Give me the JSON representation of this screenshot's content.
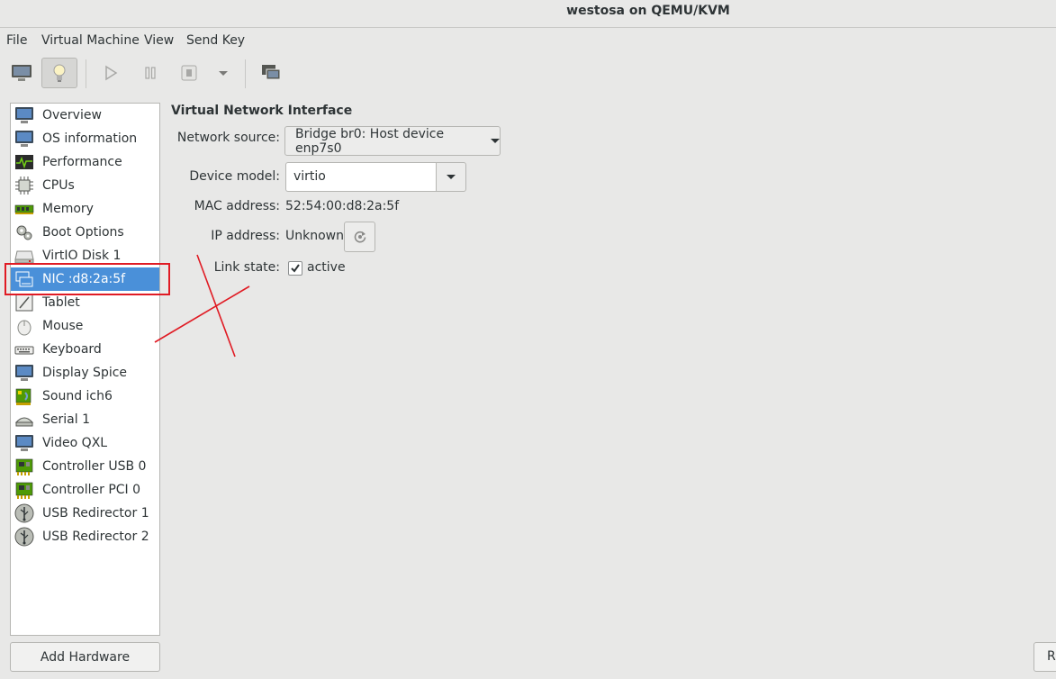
{
  "window": {
    "title": "westosa on QEMU/KVM"
  },
  "menubar": {
    "items": [
      "File",
      "Virtual Machine",
      "View",
      "Send Key"
    ]
  },
  "toolbar": {
    "buttons": [
      "monitor-icon",
      "lightbulb-icon",
      "play-icon",
      "pause-icon",
      "stop-icon",
      "dropdown-arrow-icon",
      "screens-icon"
    ],
    "active": "lightbulb-icon"
  },
  "sidebar": {
    "items": [
      {
        "label": "Overview",
        "icon": "monitor-icon"
      },
      {
        "label": "OS information",
        "icon": "monitor-icon"
      },
      {
        "label": "Performance",
        "icon": "performance-graph-icon"
      },
      {
        "label": "CPUs",
        "icon": "cpu-chip-icon"
      },
      {
        "label": "Memory",
        "icon": "memory-module-icon"
      },
      {
        "label": "Boot Options",
        "icon": "gears-icon"
      },
      {
        "label": "VirtIO Disk 1",
        "icon": "disk-drive-icon"
      },
      {
        "label": "NIC :d8:2a:5f",
        "icon": "network-card-icon",
        "selected": true
      },
      {
        "label": "Tablet",
        "icon": "tablet-icon"
      },
      {
        "label": "Mouse",
        "icon": "mouse-icon"
      },
      {
        "label": "Keyboard",
        "icon": "keyboard-icon"
      },
      {
        "label": "Display Spice",
        "icon": "monitor-icon"
      },
      {
        "label": "Sound ich6",
        "icon": "sound-card-icon"
      },
      {
        "label": "Serial 1",
        "icon": "serial-port-icon"
      },
      {
        "label": "Video QXL",
        "icon": "monitor-icon"
      },
      {
        "label": "Controller USB 0",
        "icon": "controller-card-icon"
      },
      {
        "label": "Controller PCI 0",
        "icon": "controller-card-icon"
      },
      {
        "label": "USB Redirector 1",
        "icon": "usb-icon"
      },
      {
        "label": "USB Redirector 2",
        "icon": "usb-icon"
      }
    ]
  },
  "footer": {
    "add_hardware": "Add Hardware",
    "right_button": "R"
  },
  "detail": {
    "heading": "Virtual Network Interface",
    "network_source_label": "Network source:",
    "network_source_value": "Bridge br0: Host device enp7s0",
    "device_model_label": "Device model:",
    "device_model_value": "virtio",
    "mac_label": "MAC address:",
    "mac_value": "52:54:00:d8:2a:5f",
    "ip_label": "IP address:",
    "ip_value": "Unknown",
    "link_state_label": "Link state:",
    "link_state_value": "active",
    "link_state_checked": true
  },
  "colors": {
    "selection": "#4a90d9",
    "annotation": "#e01b24"
  }
}
